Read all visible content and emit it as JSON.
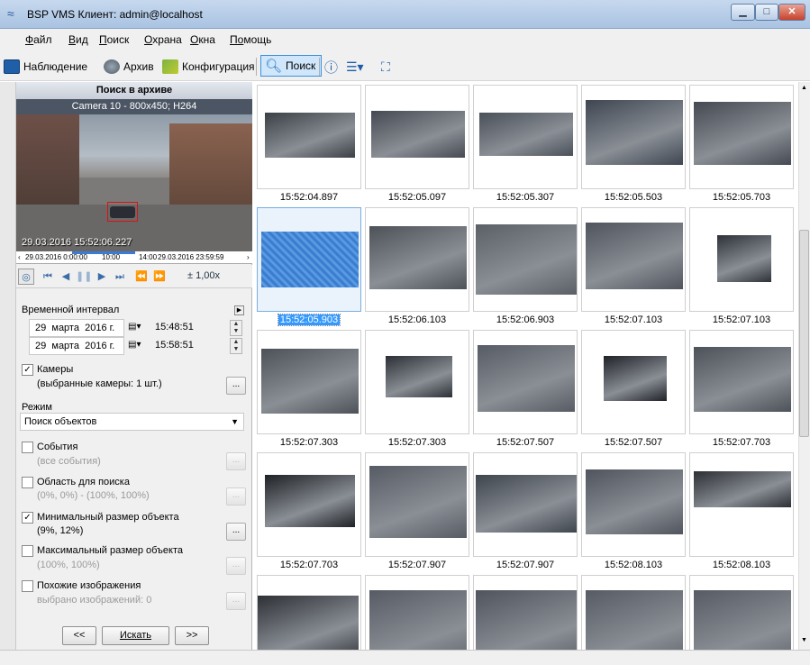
{
  "window": {
    "title": "BSP VMS Клиент: admin@localhost"
  },
  "menu": [
    {
      "first": "Ф",
      "rest": "айл"
    },
    {
      "first": "В",
      "rest": "ид"
    },
    {
      "first": "П",
      "rest": "оиск"
    },
    {
      "first": "О",
      "rest": "храна"
    },
    {
      "first": "О",
      "rest": "кна"
    },
    {
      "first": "По",
      "rest": "мощь"
    }
  ],
  "toolbar": {
    "monitoring": "Наблюдение",
    "archive": "Архив",
    "configuration": "Конфигурация",
    "search": "Поиск"
  },
  "panel": {
    "header": "Поиск в архиве",
    "camera": "Camera 10 - 800x450; H264",
    "video_timestamp": "29.03.2016 15:52:06.227",
    "timeline": {
      "start": "29.03.2016 0:00:00",
      "mark1": "10:00",
      "mark2": "14:00",
      "end": "29.03.2016 23:59:59"
    },
    "speed": "± 1,00x",
    "interval_label": "Временной интервал",
    "from": {
      "day": "29",
      "month": "марта",
      "year": "2016 г.",
      "time": "15:48:51"
    },
    "to": {
      "day": "29",
      "month": "марта",
      "year": "2016 г.",
      "time": "15:58:51"
    },
    "cameras": {
      "label": "Камеры",
      "sub": "(выбранные камеры: 1 шт.)",
      "checked": true
    },
    "mode_label": "Режим",
    "mode_value": "Поиск объектов",
    "events": {
      "label": "События",
      "sub": "(все события)",
      "checked": false
    },
    "area": {
      "label": "Область для поиска",
      "sub": "(0%, 0%) - (100%, 100%)",
      "checked": false
    },
    "min_size": {
      "label": "Минимальный размер объекта",
      "sub": "(9%, 12%)",
      "checked": true
    },
    "max_size": {
      "label": "Максимальный размер объекта",
      "sub": "(100%, 100%)",
      "checked": false
    },
    "similar": {
      "label": "Похожие изображения",
      "sub": "выбрано изображений: 0",
      "checked": false
    },
    "prev_btn": "<<",
    "search_btn": "Искать",
    "next_btn": ">>",
    "dots": "..."
  },
  "results": [
    [
      "15:52:04.897",
      "15:52:05.097",
      "15:52:05.307",
      "15:52:05.503",
      "15:52:05.703"
    ],
    [
      "15:52:05.903",
      "15:52:06.103",
      "15:52:06.903",
      "15:52:07.103",
      "15:52:07.103"
    ],
    [
      "15:52:07.303",
      "15:52:07.303",
      "15:52:07.507",
      "15:52:07.507",
      "15:52:07.703"
    ],
    [
      "15:52:07.703",
      "15:52:07.907",
      "15:52:07.907",
      "15:52:08.103",
      "15:52:08.103"
    ],
    [
      "",
      "",
      "",
      "",
      ""
    ]
  ],
  "selected_result": "15:52:05.903"
}
